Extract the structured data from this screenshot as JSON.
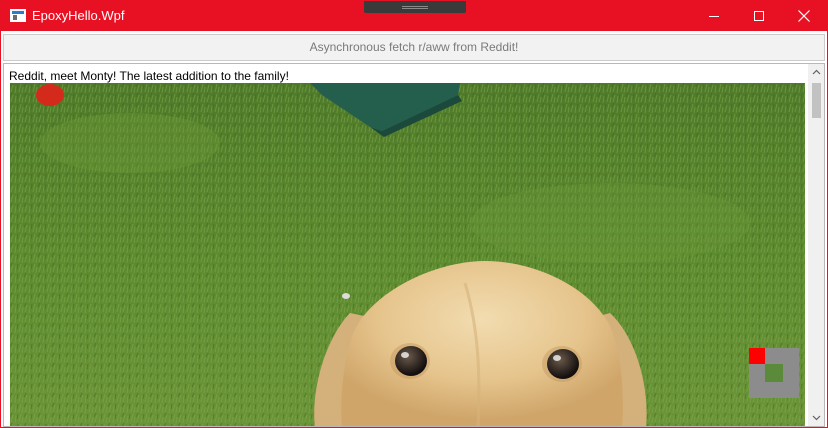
{
  "window": {
    "title": "EpoxyHello.Wpf",
    "accent_color": "#e81123",
    "controls": {
      "minimize_icon": "minimize-icon",
      "maximize_icon": "maximize-icon",
      "close_icon": "close-icon"
    }
  },
  "toolbar": {
    "fetch_label": "Asynchronous fetch r/aww from Reddit!"
  },
  "post": {
    "title": "Reddit, meet Monty! The latest addition to the family!",
    "image_subject": "labrador-puppy-on-grass"
  },
  "scrollbar": {
    "up_icon": "chevron-up-icon",
    "down_icon": "chevron-down-icon"
  },
  "indicator": {
    "icon": "render-indicator-icon"
  }
}
